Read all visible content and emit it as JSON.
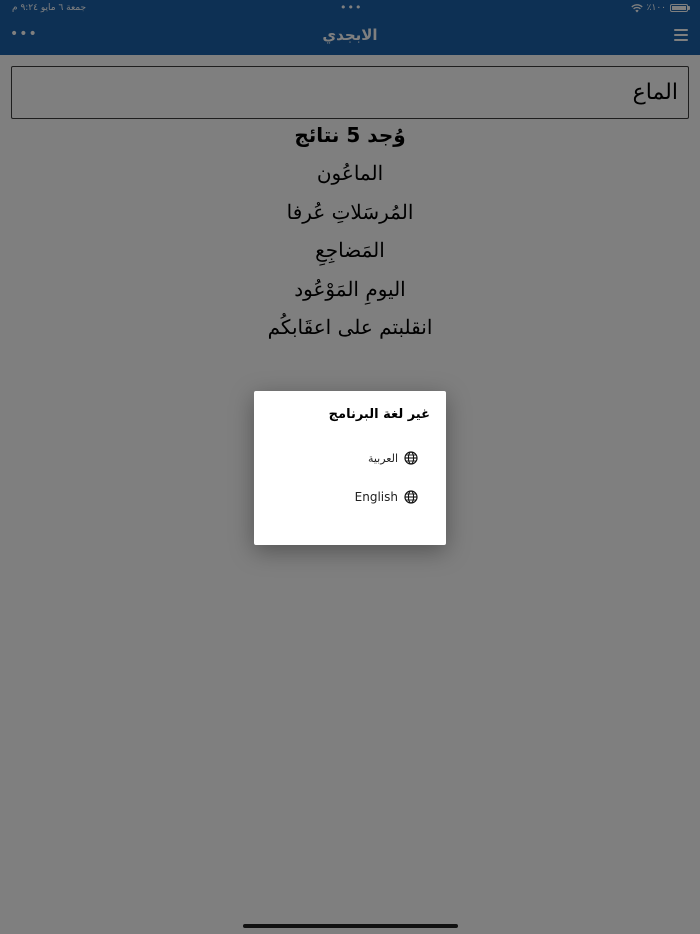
{
  "status_bar": {
    "date": "جمعة ٦ مايو",
    "time": "٩:٢٤ م",
    "center_dots": "•••",
    "battery": "٪١٠٠",
    "wifi_icon": "wifi-icon",
    "battery_icon": "battery-icon"
  },
  "nav": {
    "title": "الابجدي",
    "more_icon": "•••",
    "menu_icon": "hamburger-icon"
  },
  "search": {
    "value": "الماع"
  },
  "results": {
    "count_text": "وُجد 5 نتائج",
    "items": [
      "الماعُون",
      "المُرسَلاتِ عُرفا",
      "المَضاجِعِ",
      "اليومِ المَوْعُود",
      "انقلبتم على اعقَابكُم"
    ]
  },
  "dialog": {
    "title": "غير لغة البرنامج",
    "options": [
      {
        "label": "العربية",
        "icon": "globe-icon"
      },
      {
        "label": "English",
        "icon": "globe-icon"
      }
    ]
  },
  "colors": {
    "nav_bg": "#1a61a8",
    "overlay": "rgba(0,0,0,0.5)",
    "dialog_bg": "#ffffff"
  }
}
